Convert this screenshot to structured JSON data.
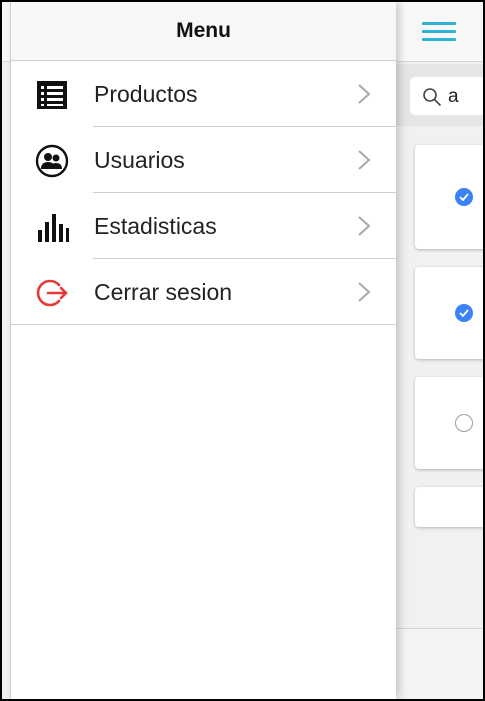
{
  "menu": {
    "title": "Menu",
    "items": [
      {
        "label": "Productos",
        "icon": "list-icon"
      },
      {
        "label": "Usuarios",
        "icon": "users-icon"
      },
      {
        "label": "Estadisticas",
        "icon": "bar-chart-icon"
      },
      {
        "label": "Cerrar sesion",
        "icon": "logout-icon"
      }
    ]
  },
  "page": {
    "search": {
      "value": "a"
    },
    "cards": [
      {
        "checked": true
      },
      {
        "checked": true
      },
      {
        "checked": false
      }
    ]
  },
  "colors": {
    "accent": "#2fb3d4",
    "check": "#3b82f6",
    "logout": "#e53935"
  }
}
